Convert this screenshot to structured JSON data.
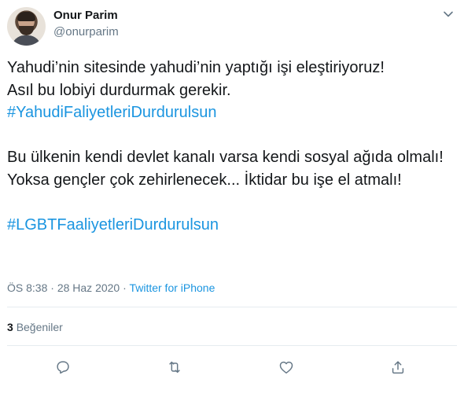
{
  "user": {
    "name": "Onur Parim",
    "handle": "@onurparim"
  },
  "tweet": {
    "line1": "Yahudi’nin sitesinde yahudi’nin yaptığı işi eleştiriyoruz!",
    "line2": "Asıl bu lobiyi durdurmak gerekir.",
    "hashtag1": "#YahudiFaliyetleriDurdurulsun",
    "paragraph2": "Bu ülkenin kendi devlet kanalı varsa kendi sosyal ağıda olmalı! Yoksa gençler çok zehirlenecek... İktidar bu işe el atmalı!",
    "hashtag2": "#LGBTFaaliyetleriDurdurulsun"
  },
  "meta": {
    "time": "ÖS 8:38",
    "separator": "·",
    "date": "28 Haz 2020",
    "source": "Twitter for iPhone"
  },
  "likes": {
    "count": "3",
    "label": "Beğeniler"
  },
  "colors": {
    "link": "#1b95e0",
    "secondary_text": "#657786",
    "icon": "#657786",
    "divider": "#e6ecf0"
  },
  "icons": [
    "chevron-down-icon",
    "reply-icon",
    "retweet-icon",
    "like-icon",
    "share-icon"
  ]
}
